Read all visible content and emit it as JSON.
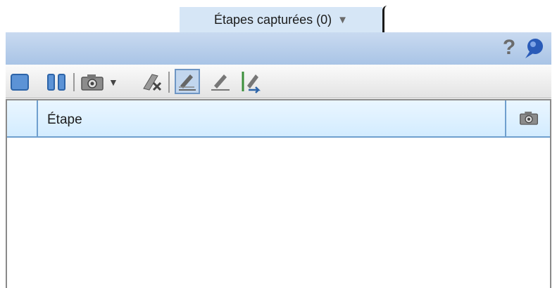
{
  "tab": {
    "label": "Étapes capturées (0)",
    "dropdown_icon": "dropdown-arrow-icon"
  },
  "header": {
    "help_icon": "help-icon",
    "pin_icon": "pin-icon",
    "help_glyph": "?"
  },
  "toolbar": {
    "buttons": [
      "stop-icon",
      "pause-icon",
      "camera-icon",
      "chevron-down-icon",
      "delete-capture-icon",
      "annotate-icon",
      "edit-icon",
      "move-steps-icon"
    ],
    "camera_dropdown_glyph": "▼"
  },
  "table": {
    "columns": [
      "",
      "Étape",
      ""
    ],
    "camera_column_icon": "camera-icon",
    "rows": []
  },
  "colors": {
    "header_blue": "#a9c4e6",
    "accent": "#6f9fce",
    "tab_bg": "#d6e6f6"
  }
}
